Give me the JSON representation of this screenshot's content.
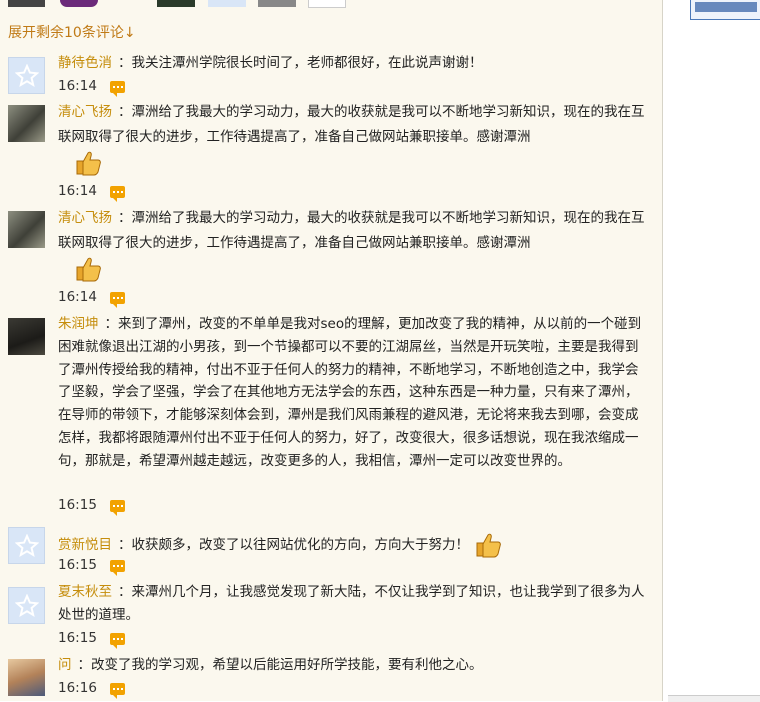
{
  "expand_link": "展开剩余10条评论↓",
  "comments": [
    {
      "user": "静待色消",
      "text": "：我关注潭州学院很长时间了，老师都很好，在此说声谢谢！",
      "time": "16:14"
    },
    {
      "user": "清心飞扬",
      "text": "：潭洲给了我最大的学习动力，最大的收获就是我可以不断地学习新知识，现在的我在互联网取得了很大的进步，工作待遇提高了，准备自己做网站兼职接单。感谢潭洲",
      "time": "16:14"
    },
    {
      "user": "清心飞扬",
      "text": "：潭洲给了我最大的学习动力，最大的收获就是我可以不断地学习新知识，现在的我在互联网取得了很大的进步，工作待遇提高了，准备自己做网站兼职接单。感谢潭洲",
      "time": "16:14"
    },
    {
      "user": "朱润坤",
      "text": "：来到了潭州，改变的不单单是我对seo的理解，更加改变了我的精神，从以前的一个碰到困难就像退出江湖的小男孩，到一个节操都可以不要的江湖屌丝，当然是开玩笑啦，主要是我得到了潭州传授给我的精神，付出不亚于任何人的努力的精神，不断地学习，不断地创造之中，我学会了坚毅，学会了坚强，学会了在其他地方无法学会的东西，这种东西是一种力量，只有来了潭州，在导师的带领下，才能够深刻体会到，潭州是我们风雨兼程的避风港，无论将来我去到哪，会变成怎样，我都将跟随潭州付出不亚于任何人的努力，好了，改变很大，很多话想说，现在我浓缩成一句，那就是，希望潭州越走越远，改变更多的人，我相信，潭州一定可以改变世界的。",
      "time": "16:15"
    },
    {
      "user": "赏新悦目",
      "text": "：收获颇多，改变了以往网站优化的方向，方向大于努力！",
      "time": "16:15"
    },
    {
      "user": "夏末秋至",
      "text": "：来潭州几个月，让我感觉发现了新大陆，不仅让我学到了知识，也让我学到了很多为人处世的道理。",
      "time": "16:15"
    },
    {
      "user": "问",
      "text": "：改变了我的学习观，希望以后能运用好所学技能，要有利他之心。",
      "time": "16:16"
    }
  ],
  "colors": {
    "username": "#c58d0c",
    "expand": "#c07a16",
    "reply_icon": "#f2a200",
    "panel_bg": "#fbf8ee"
  },
  "icons": {
    "reply": "reply-bubble-icon",
    "thumb": "thumbs-up-icon",
    "default_avatar": "star-avatar-icon"
  }
}
